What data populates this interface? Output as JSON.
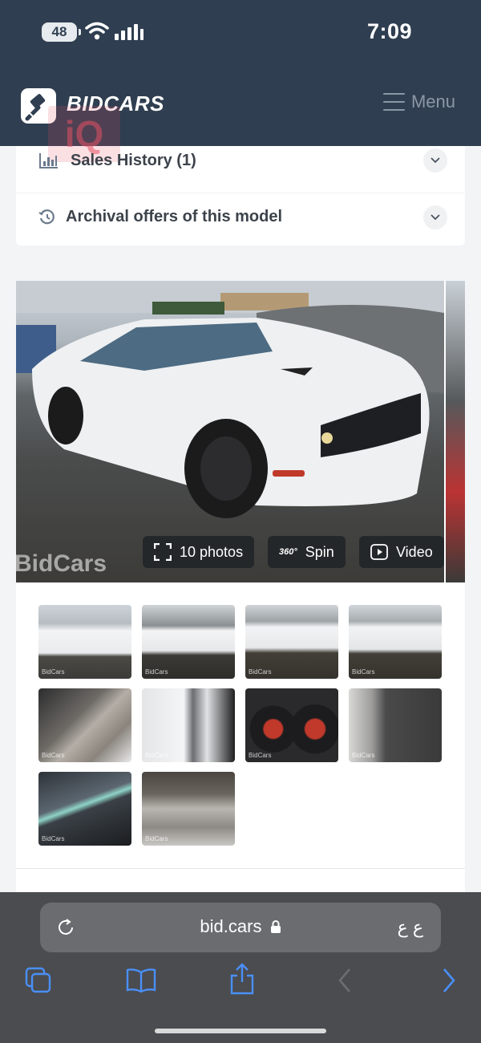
{
  "status_bar": {
    "battery": "48",
    "time": "7:09"
  },
  "header": {
    "brand": "BIDCARS",
    "menu_label": "Menu"
  },
  "accordion": {
    "watermark": "iQ",
    "items": [
      {
        "label": "Sales History (1)",
        "icon": "bar-chart-icon"
      },
      {
        "label": "Archival offers of this model",
        "icon": "history-icon"
      }
    ]
  },
  "gallery": {
    "watermark": "BidCars",
    "photos_label": "10 photos",
    "spin_label": "Spin",
    "spin_badge": "360°",
    "video_label": "Video",
    "thumbnails": [
      {
        "label": "front-left exterior"
      },
      {
        "label": "front exterior"
      },
      {
        "label": "rear-left exterior"
      },
      {
        "label": "rear exterior"
      },
      {
        "label": "interior front seats"
      },
      {
        "label": "damaged side panel"
      },
      {
        "label": "instrument cluster"
      },
      {
        "label": "rear seats"
      },
      {
        "label": "dashboard odometer"
      },
      {
        "label": "engine bay"
      }
    ],
    "thumb_watermark": "BidCars"
  },
  "browser": {
    "url": "bid.cars",
    "reader_label": "ع ع"
  },
  "colors": {
    "header_bg": "#2f3e50",
    "accent_blue": "#3b82f6",
    "safari_bg": "#4a4c50"
  }
}
